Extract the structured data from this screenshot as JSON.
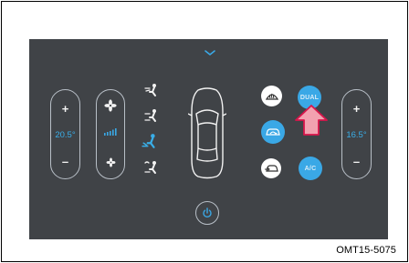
{
  "reference_code": "OMT15-5075",
  "left_temp": {
    "plus": "+",
    "value": "20.5°",
    "minus": "–"
  },
  "right_temp": {
    "plus": "+",
    "value": "16.5°",
    "minus": "–"
  },
  "buttons": {
    "dual": "DUAL",
    "ac": "A/C"
  },
  "colors": {
    "accent": "#3aa8e6",
    "screen": "#404347",
    "outline": "#b8bfc7",
    "arrow_fill": "#f2a1b0",
    "arrow_stroke": "#d8154b"
  },
  "icons": [
    "chevron-down-icon",
    "fan-high-icon",
    "fan-speed-bars-icon",
    "fan-low-icon",
    "vent-face-icon",
    "vent-face-feet-icon",
    "vent-feet-icon",
    "vent-defrost-feet-icon",
    "car-top-view-icon",
    "front-defrost-icon",
    "air-recirculation-icon",
    "fresh-air-icon",
    "power-icon",
    "callout-arrow-icon"
  ]
}
